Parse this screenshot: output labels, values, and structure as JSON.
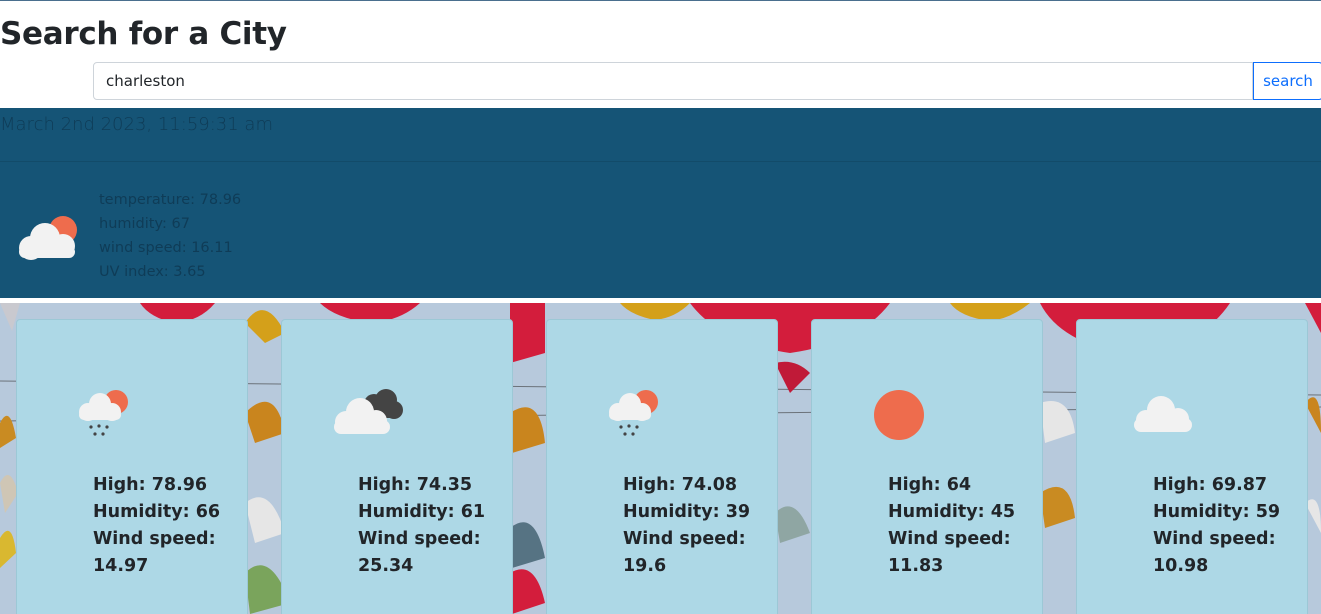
{
  "page": {
    "title": "Search for a City"
  },
  "search": {
    "value": "charleston",
    "button_label": "search"
  },
  "current": {
    "date": "March 2nd 2023, 11:59:31 am",
    "icon": "cloud-sun-icon",
    "temperature": "temperature: 78.96",
    "humidity": "humidity: 67",
    "wind_speed": "wind speed: 16.11",
    "uv_index": "UV index: 3.65"
  },
  "forecast": [
    {
      "icon": "rain-sun-icon",
      "high": "High: 78.96",
      "humidity": "Humidity: 66",
      "wind_label": "Wind speed:",
      "wind_value": "14.97"
    },
    {
      "icon": "cloudy-icon",
      "high": "High: 74.35",
      "humidity": "Humidity: 61",
      "wind_label": "Wind speed:",
      "wind_value": "25.34"
    },
    {
      "icon": "rain-sun-icon",
      "high": "High: 74.08",
      "humidity": "Humidity: 39",
      "wind_label": "Wind speed:",
      "wind_value": "19.6"
    },
    {
      "icon": "sun-icon",
      "high": "High: 64",
      "humidity": "Humidity: 45",
      "wind_label": "Wind speed:",
      "wind_value": "11.83"
    },
    {
      "icon": "cloud-icon",
      "high": "High: 69.87",
      "humidity": "Humidity: 59",
      "wind_label": "Wind speed:",
      "wind_value": "10.98"
    }
  ],
  "colors": {
    "current_bg": "#155476",
    "card_bg": "#add8e6",
    "sun": "#ee6c4d",
    "accent": "#0d6efd"
  }
}
